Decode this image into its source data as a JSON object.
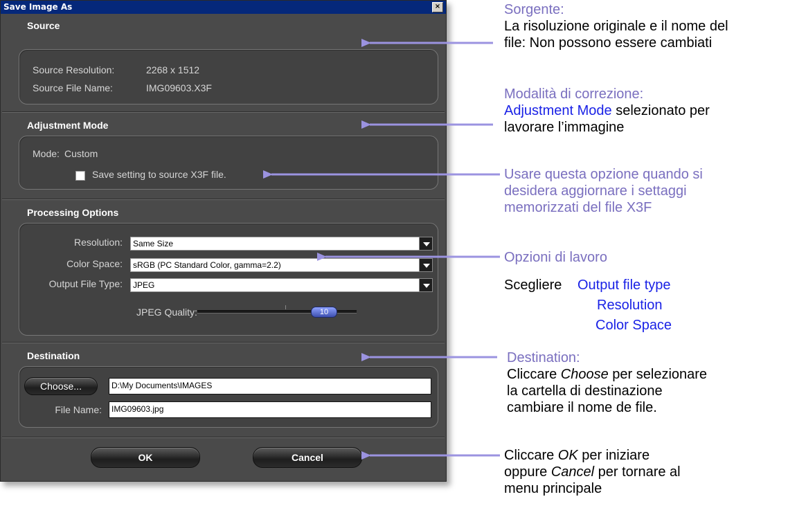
{
  "dialog": {
    "title": "Save Image As",
    "close_glyph": "×",
    "source": {
      "heading": "Source",
      "resolution_label": "Source Resolution:",
      "resolution_value": "2268 x 1512",
      "filename_label": "Source File Name:",
      "filename_value": "IMG09603.X3F"
    },
    "adjustment": {
      "heading": "Adjustment Mode",
      "mode_label": "Mode:",
      "mode_value": "Custom",
      "checkbox_label": "Save setting to source X3F file.",
      "checkbox_checked": false
    },
    "processing": {
      "heading": "Processing Options",
      "resolution_label": "Resolution:",
      "resolution_value": "Same Size",
      "color_space_label": "Color Space:",
      "color_space_value": "sRGB (PC Standard Color, gamma=2.2)",
      "output_type_label": "Output File Type:",
      "output_type_value": "JPEG",
      "jpeg_quality_label": "JPEG Quality:",
      "jpeg_quality_value": "10"
    },
    "destination": {
      "heading": "Destination",
      "choose_button": "Choose...",
      "folder_path": "D:\\My Documents\\IMAGES",
      "filename_label": "File Name:",
      "filename_value": "IMG09603.jpg"
    },
    "buttons": {
      "ok": "OK",
      "cancel": "Cancel"
    }
  },
  "annotations": {
    "source": {
      "heading": "Sorgente:",
      "line1": "La risoluzione originale e il nome del",
      "line2": "file: Non possono essere cambiati"
    },
    "adjustment": {
      "heading": "Modalità di correzione:",
      "line1_link": "Adjustment Mode",
      "line1_rest": " selezionato per",
      "line2": "lavorare l’immagine"
    },
    "checkbox": {
      "line1": "Usare questa opzione quando si",
      "line2": "desidera aggiornare i settaggi",
      "line3": "memorizzati del file X3F"
    },
    "processing": {
      "heading": "Opzioni di lavoro",
      "choose_label": "Scegliere",
      "option1": "Output file type",
      "option2": "Resolution",
      "option3": "Color Space"
    },
    "destination": {
      "heading": "Destination:",
      "line1_pre": "Cliccare ",
      "line1_em": "Choose",
      "line1_post": " per selezionare",
      "line2": "la cartella di destinazione",
      "line3": "cambiare il nome de file."
    },
    "buttons": {
      "line1_pre": "Cliccare ",
      "line1_em": "OK",
      "line1_post": " per  iniziare",
      "line2_pre": "oppure ",
      "line2_em": "Cancel",
      "line2_post": " per tornare al",
      "line3": "menu principale"
    }
  },
  "colors": {
    "arrow": "#9b93e0",
    "annotation_heading": "#7a6fbf",
    "annotation_link": "#1a22e6",
    "titlebar": "#05287a",
    "dialog_bg": "#4a4a4a"
  }
}
